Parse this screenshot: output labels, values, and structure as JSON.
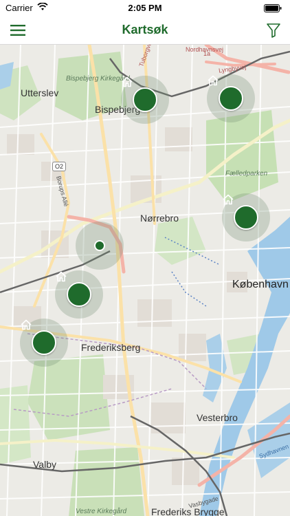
{
  "status_bar": {
    "carrier": "Carrier",
    "time": "2:05 PM"
  },
  "nav_bar": {
    "title": "Kartsøk",
    "menu_icon": "hamburger-menu-icon",
    "filter_icon": "funnel-filter-icon",
    "title_color": "#1f6b2c"
  },
  "map": {
    "labels": {
      "utterslev": "Utterslev",
      "bispebjerg": "Bispebjerg",
      "bispebjerg_kirkegard": "Bispebjerg Kirkegård",
      "norrebro": "Nørrebro",
      "faelledparken": "Fælledparken",
      "kobenhavn": "København",
      "frederiksberg": "Frederiksberg",
      "vesterbro": "Vesterbro",
      "valby": "Valby",
      "frederiks_brygge": "Frederiks Brygge",
      "vestre_kirkegard": "Vestre Kirkegård",
      "o2": "O2",
      "bellahojvej": "Tuborgvej",
      "nordhavnsvej": "Nordhavnsvej",
      "lyngbyvej": "Lyngbyvej",
      "bellahoj_alle": "Borups Allé",
      "sydhavnen": "Sydhavnen",
      "vasbygade": "Vasbygade",
      "route_1a": "1a"
    },
    "marker_icon": "house-icon",
    "marker_color": "#1f6b2c"
  }
}
